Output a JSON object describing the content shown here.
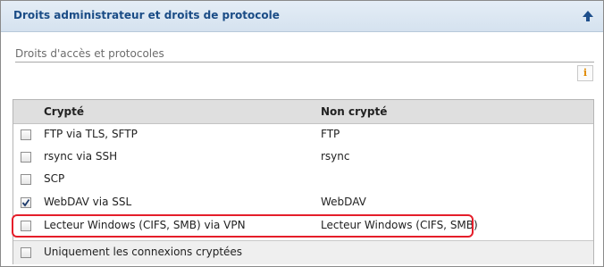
{
  "header": {
    "title": "Droits administrateur et droits de protocole"
  },
  "section": {
    "label": "Droits d'accès et protocoles",
    "info_label": "i"
  },
  "table": {
    "col_encrypted": "Crypté",
    "col_unencrypted": "Non crypté",
    "rows": [
      {
        "encrypted": "FTP via TLS, SFTP",
        "unencrypted": "FTP",
        "checked": false
      },
      {
        "encrypted": "rsync via SSH",
        "unencrypted": "rsync",
        "checked": false
      },
      {
        "encrypted": "SCP",
        "unencrypted": "",
        "checked": false
      },
      {
        "encrypted": "WebDAV via SSL",
        "unencrypted": "WebDAV",
        "checked": true
      },
      {
        "encrypted": "Lecteur Windows (CIFS, SMB) via VPN",
        "unencrypted": "Lecteur Windows (CIFS, SMB)",
        "checked": false,
        "highlighted": true
      }
    ],
    "footer": {
      "label": "Uniquement les connexions cryptées",
      "checked": false
    }
  },
  "colors": {
    "header_title": "#1a4c86",
    "highlight": "#e51e2a",
    "info_icon": "#e08a00"
  }
}
